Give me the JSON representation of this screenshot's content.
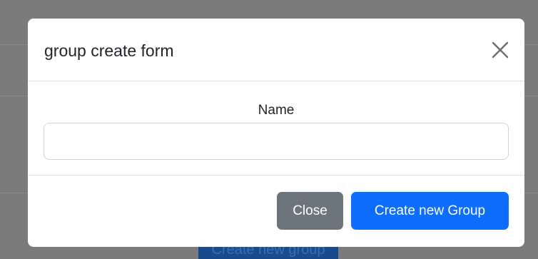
{
  "background": {
    "button_label": "Create new group"
  },
  "modal": {
    "title": "group create form",
    "close_icon": "close-x-icon",
    "form": {
      "name_label": "Name",
      "name_value": "",
      "name_placeholder": ""
    },
    "footer": {
      "close_label": "Close",
      "create_label": "Create new Group"
    }
  },
  "colors": {
    "overlay": "#7b7b7b",
    "primary": "#0d6efd",
    "secondary": "#6c757d"
  }
}
